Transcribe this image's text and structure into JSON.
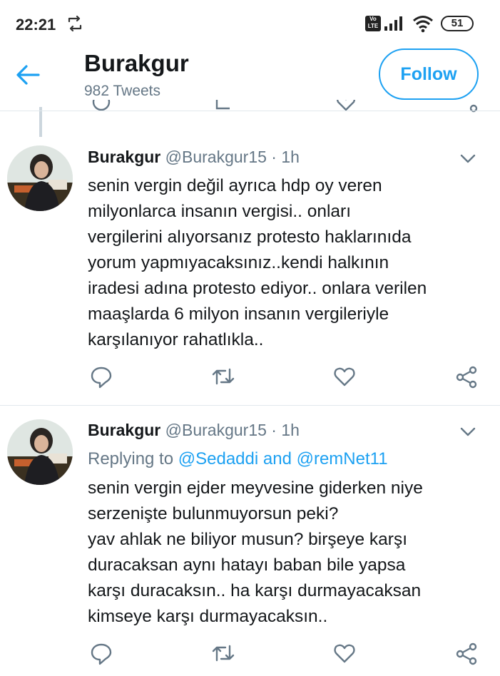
{
  "status_bar": {
    "time": "22:21",
    "volte": "Vo LTE",
    "battery": "51",
    "icons": [
      "sync-icon",
      "volte-icon",
      "signal-icon",
      "wifi-icon",
      "battery-icon"
    ]
  },
  "header": {
    "title": "Burakgur",
    "subtitle": "982 Tweets",
    "follow_label": "Follow",
    "back_icon": "back-arrow-icon"
  },
  "tweets": [
    {
      "name": "Burakgur",
      "handle": "@Burakgur15",
      "separator": "·",
      "time": "1h",
      "lines": [
        "senin vergin değil ayrıca hdp oy veren",
        "milyonlarca insanın vergisi..  onları",
        "vergilerini alıyorsanız protesto haklarınıda",
        "yorum yapmıyacaksınız..kendi halkının",
        "iradesi adına protesto ediyor.. onlara  verilen",
        "maaşlarda 6 milyon insanın vergileriyle",
        "karşılanıyor rahatlıkla.."
      ]
    },
    {
      "name": "Burakgur",
      "handle": "@Burakgur15",
      "separator": "·",
      "time": "1h",
      "reply_prefix": "Replying to",
      "reply_user1": "@Sedaddi",
      "reply_and": "and",
      "reply_user2": "@remNet11",
      "lines": [
        "senin vergin ejder meyvesine giderken niye",
        "serzenişte bulunmuyorsun peki?",
        "yav ahlak ne biliyor musun? birşeye karşı",
        "duracaksan aynı hatayı baban bile yapsa",
        "karşı duracaksın.. ha karşı durmayacaksan",
        "kimseye karşı durmayacaksın.."
      ]
    }
  ],
  "colors": {
    "accent": "#1da1f2",
    "text": "#14171a",
    "secondary": "#657786",
    "divider": "#e1e8ed"
  }
}
